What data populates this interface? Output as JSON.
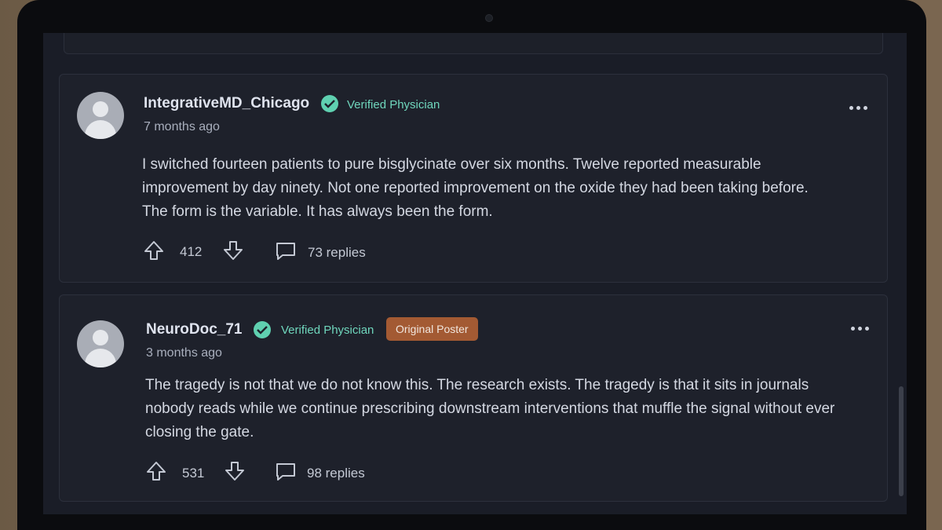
{
  "comments": [
    {
      "username": "IntegrativeMD_Chicago",
      "badge": "Verified Physician",
      "time": "7 months ago",
      "text": "I switched fourteen patients to pure bisglycinate over six months. Twelve reported measurable improvement by day ninety. Not one reported improvement on the oxide they had been taking before. The form is the variable. It has always been the form.",
      "upvotes": "412",
      "replies": "73 replies"
    },
    {
      "username": "NeuroDoc_71",
      "badge": "Verified Physician",
      "op_badge": "Original Poster",
      "time": "3 months ago",
      "text": "The tragedy is not that we do not know this. The research exists. The tragedy is that it sits in journals nobody reads while we continue prescribing downstream interventions that muffle the signal without ever closing the gate.",
      "upvotes": "531",
      "replies": "98 replies"
    }
  ],
  "colors": {
    "background": "#1a1d27",
    "card": "#1e212b",
    "verified": "#6fd6bc",
    "op_badge": "#a35a33"
  },
  "icons": [
    "upvote-icon",
    "downvote-icon",
    "comment-icon",
    "more-options-icon",
    "verified-check-icon",
    "avatar-icon"
  ]
}
